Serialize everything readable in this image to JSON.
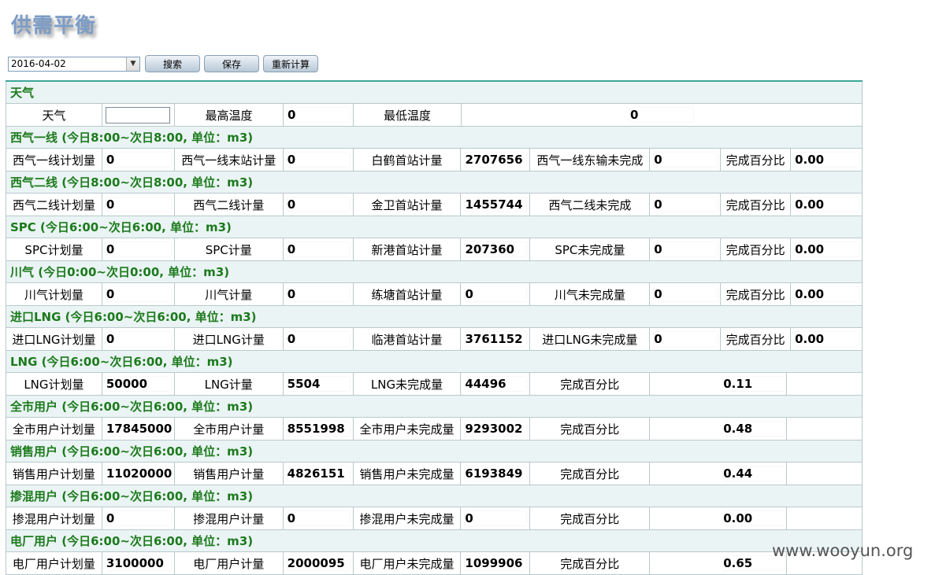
{
  "title": "供需平衡",
  "toolbar": {
    "date_value": "2016-04-02",
    "search_label": "搜索",
    "save_label": "保存",
    "recalc_label": "重新计算"
  },
  "weather": {
    "header": "天气",
    "weather_label": "天气",
    "weather_value": "",
    "max_temp_label": "最高温度",
    "max_temp_value": "0",
    "min_temp_label": "最低温度",
    "min_temp_value": "0"
  },
  "sections6": [
    {
      "header": "西气一线 (今日8:00~次日8:00, 单位：m3)",
      "cells": [
        "西气一线计划量",
        "0",
        "西气一线末站计量",
        "0",
        "白鹤首站计量",
        "2707656",
        "西气一线东输未完成",
        "0",
        "完成百分比",
        "0.00"
      ]
    },
    {
      "header": "西气二线 (今日8:00~次日8:00, 单位：m3)",
      "cells": [
        "西气二线计划量",
        "0",
        "西气二线计量",
        "0",
        "金卫首站计量",
        "1455744",
        "西气二线未完成",
        "0",
        "完成百分比",
        "0.00"
      ]
    },
    {
      "header": "SPC (今日6:00~次日6:00, 单位：m3)",
      "cells": [
        "SPC计划量",
        "0",
        "SPC计量",
        "0",
        "新港首站计量",
        "207360",
        "SPC未完成量",
        "0",
        "完成百分比",
        "0.00"
      ]
    },
    {
      "header": "川气 (今日0:00~次日0:00, 单位：m3)",
      "cells": [
        "川气计划量",
        "0",
        "川气计量",
        "0",
        "练塘首站计量",
        "0",
        "川气未完成量",
        "0",
        "完成百分比",
        "0.00"
      ]
    },
    {
      "header": "进口LNG (今日6:00~次日6:00, 单位：m3)",
      "cells": [
        "进口LNG计划量",
        "0",
        "进口LNG计量",
        "0",
        "临港首站计量",
        "3761152",
        "进口LNG未完成量",
        "0",
        "完成百分比",
        "0.00"
      ]
    }
  ],
  "sections4": [
    {
      "header": "LNG (今日6:00~次日6:00, 单位：m3)",
      "cells": [
        "LNG计划量",
        "50000",
        "LNG计量",
        "5504",
        "LNG未完成量",
        "44496",
        "完成百分比",
        "0.11"
      ]
    },
    {
      "header": "全市用户 (今日6:00~次日6:00, 单位：m3)",
      "cells": [
        "全市用户计划量",
        "17845000",
        "全市用户计量",
        "8551998",
        "全市用户未完成量",
        "9293002",
        "完成百分比",
        "0.48"
      ]
    },
    {
      "header": "销售用户 (今日6:00~次日6:00, 单位：m3)",
      "cells": [
        "销售用户计划量",
        "11020000",
        "销售用户计量",
        "4826151",
        "销售用户未完成量",
        "6193849",
        "完成百分比",
        "0.44"
      ]
    },
    {
      "header": "掺混用户 (今日6:00~次日6:00, 单位：m3)",
      "cells": [
        "掺混用户计划量",
        "0",
        "掺混用户计量",
        "0",
        "掺混用户未完成量",
        "0",
        "完成百分比",
        "0.00"
      ]
    },
    {
      "header": "电厂用户 (今日6:00~次日6:00, 单位：m3)",
      "cells": [
        "电厂用户计划量",
        "3100000",
        "电厂用户计量",
        "2000095",
        "电厂用户未完成量",
        "1099906",
        "完成百分比",
        "0.65"
      ]
    }
  ],
  "watermark": "www.wooyun.org"
}
